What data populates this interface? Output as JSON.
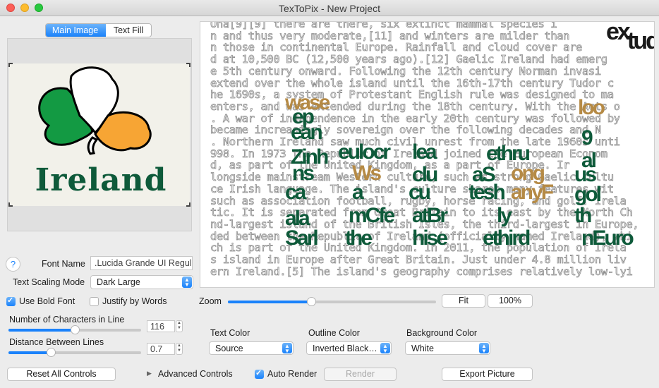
{
  "window": {
    "title": "TexToPix - New Project"
  },
  "tabs": {
    "main_image": "Main Image",
    "text_fill": "Text Fill"
  },
  "preview": {
    "logo_text": "Ireland"
  },
  "colors": {
    "accent": "#1a82fb",
    "shamrock_green": "#139a43",
    "shamrock_orange": "#f7a534",
    "logo_text": "#0e5a3a",
    "close": "#fc5f57",
    "minimize": "#fdbc2e",
    "maximize": "#28c840"
  },
  "controls": {
    "help_label": "?",
    "font_name_label": "Font Name",
    "font_name_value": ".Lucida Grande UI Regul",
    "scaling_label": "Text Scaling Mode",
    "scaling_value": "Dark Large",
    "bold_label": "Use Bold Font",
    "bold_checked": true,
    "justify_label": "Justify by Words",
    "justify_checked": false,
    "chars_label": "Number of Characters in Line",
    "chars_value": "116",
    "chars_slider": 0.5,
    "distance_label": "Distance Between Lines",
    "distance_value": "0.7",
    "distance_slider": 0.32,
    "reset_label": "Reset All Controls",
    "advanced_label": "Advanced Controls",
    "auto_render_label": "Auto Render",
    "auto_render_checked": true,
    "render_label": "Render",
    "export_label": "Export Picture"
  },
  "zoom": {
    "label": "Zoom",
    "slider": 0.4,
    "fit_label": "Fit",
    "percent_label": "100%"
  },
  "colors_panel": {
    "text_color_label": "Text Color",
    "text_color_value": "Source",
    "outline_label": "Outline Color",
    "outline_value": "Inverted Black…",
    "background_label": "Background Color",
    "background_value": "White"
  },
  "canvas": {
    "lines": [
      "Ona[9][9] there are there, six extinct mammal species i",
      "n and thus very moderate,[11] and winters are milder than",
      "n those in continental Europe. Rainfall and cloud cover are",
      "d at 10,500 BC (12,500 years ago).[12] Gaelic Ireland had emerg",
      "e 5th century onward. Following the 12th century Norman invasi",
      "extend over the whole island until the 16th-17th century Tudor c",
      "he 1690s, a system of Protestant English rule was designed to ma",
      "enters, and was extended during the 18th century. With the Acts o",
      ". A war of independence in the early 20th century was followed by",
      "became increasingly sovereign over the following decades and N",
      ". Northern Ireland saw much civil unrest from the late 1960s unti",
      "998. In 1973 the Republic of Ireland joined the European Econom",
      "d, as part of the United Kingdom, as a part of Europe. Ir",
      "longside mainstream Western culture, such as strong Gaelic cultu",
      "ce Irish language. The island's culture shares many features wit",
      "such as association football, rugby, horse racing, and golf. Irela",
      "tic. It is separated from Great Britain to its east by the North Ch",
      "nd-largest island of the British Isles, the third-largest in Europe,",
      "ded between the Republic of Ireland (officially named Ireland), whi",
      "ch is part of the United Kingdom. In 2011, the population of Irela",
      "s island in Europe after Great Britain. Just under 4.8 million liv",
      "ern Ireland.[5] The island's geography comprises relatively low-lyi"
    ]
  }
}
